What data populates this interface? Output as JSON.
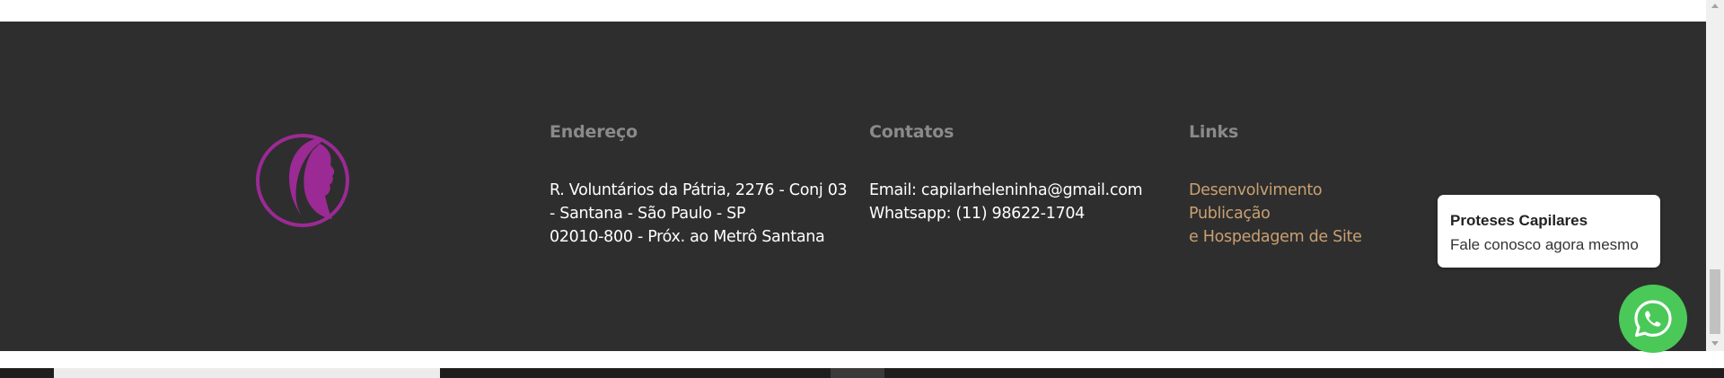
{
  "footer": {
    "address": {
      "heading": "Endereço",
      "lines": [
        "R. Voluntários da Pátria, 2276 - Conj 03",
        "- Santana - São Paulo - SP",
        "02010-800 - Próx. ao Metrô Santana"
      ]
    },
    "contacts": {
      "heading": "Contatos",
      "lines": [
        "Email: capilarheleninha@gmail.com",
        "Whatsapp: (11) 98622-1704"
      ]
    },
    "links": {
      "heading": "Links",
      "items": [
        "Desenvolvimento",
        "Publicação",
        "e Hospedagem de Site"
      ]
    }
  },
  "chat_popup": {
    "title": "Proteses Capilares",
    "message": "Fale conosco agora mesmo"
  },
  "colors": {
    "footer_background": "#2e2e2e",
    "heading": "#8a8a8a",
    "link": "#c9a071",
    "logo": "#9b2a94",
    "whatsapp": "#4ac959"
  },
  "icons": {
    "logo": "woman-profile-logo-icon",
    "whatsapp": "whatsapp-icon"
  }
}
